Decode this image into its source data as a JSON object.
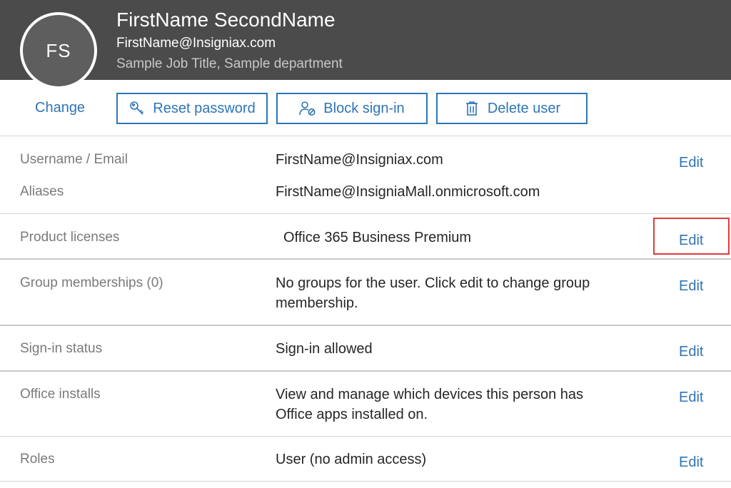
{
  "user": {
    "initials": "FS",
    "name": "FirstName SecondName",
    "email": "FirstName@Insigniax.com",
    "job": "Sample Job Title, Sample department",
    "change_label": "Change"
  },
  "actions": {
    "reset_password": {
      "label": "Reset password",
      "icon": "key-icon"
    },
    "block_signin": {
      "label": "Block sign-in",
      "icon": "user-block-icon"
    },
    "delete_user": {
      "label": "Delete user",
      "icon": "trash-icon"
    }
  },
  "details": {
    "username_label": "Username / Email",
    "username_value": "FirstName@Insigniax.com",
    "aliases_label": "Aliases",
    "aliases_value": "FirstName@InsigniaMall.onmicrosoft.com",
    "licenses_label": "Product licenses",
    "licenses_value": "Office 365 Business Premium",
    "groups_label": "Group memberships (0)",
    "groups_value": "No groups for the user. Click edit to change group membership.",
    "signin_label": "Sign-in status",
    "signin_value": "Sign-in allowed",
    "installs_label": "Office installs",
    "installs_value": "View and manage which devices this person has Office apps installed on.",
    "roles_label": "Roles",
    "roles_value": "User (no admin access)",
    "edit_label": "Edit"
  },
  "colors": {
    "header_bg": "#4b4b4b",
    "accent": "#2e75b6",
    "highlight": "#e03a3a"
  }
}
